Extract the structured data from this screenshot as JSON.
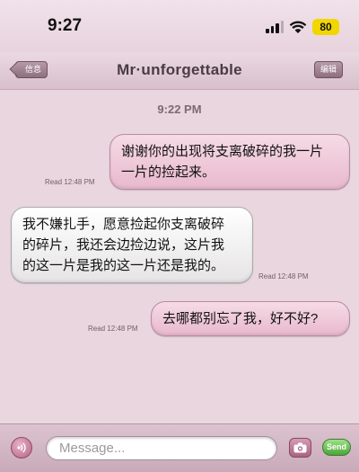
{
  "status_bar": {
    "time": "9:27",
    "battery": "80"
  },
  "nav": {
    "back_label": "信息",
    "title": "Mr·unforgettable",
    "edit_label": "编辑"
  },
  "conversation": {
    "timestamp": "9:22 PM",
    "messages": [
      {
        "direction": "sent",
        "lines": [
          "谢谢你的出现将支离破碎的我一片",
          "一片的捡起来。"
        ],
        "read": "Read 12:48 PM"
      },
      {
        "direction": "received",
        "lines": [
          "我不嫌扎手，愿意捡起你支离破碎",
          "的碎片，我还会边捡边说，这片我",
          "的这一片是我的这一片还是我的。"
        ],
        "read": "Read 12:48 PM"
      },
      {
        "direction": "sent",
        "lines": [
          "去哪都别忘了我，好不好?"
        ],
        "read": "Read 12:48 PM"
      }
    ]
  },
  "input_bar": {
    "placeholder": "Message...",
    "send_label": "Send"
  },
  "icons": {
    "audio": "audio-icon",
    "camera": "camera-icon",
    "signal": "signal-icon",
    "wifi": "wifi-icon"
  },
  "colors": {
    "sent_bubble": "#efcbd9",
    "background": "#e9d6df",
    "send_button": "#5fb84c"
  }
}
